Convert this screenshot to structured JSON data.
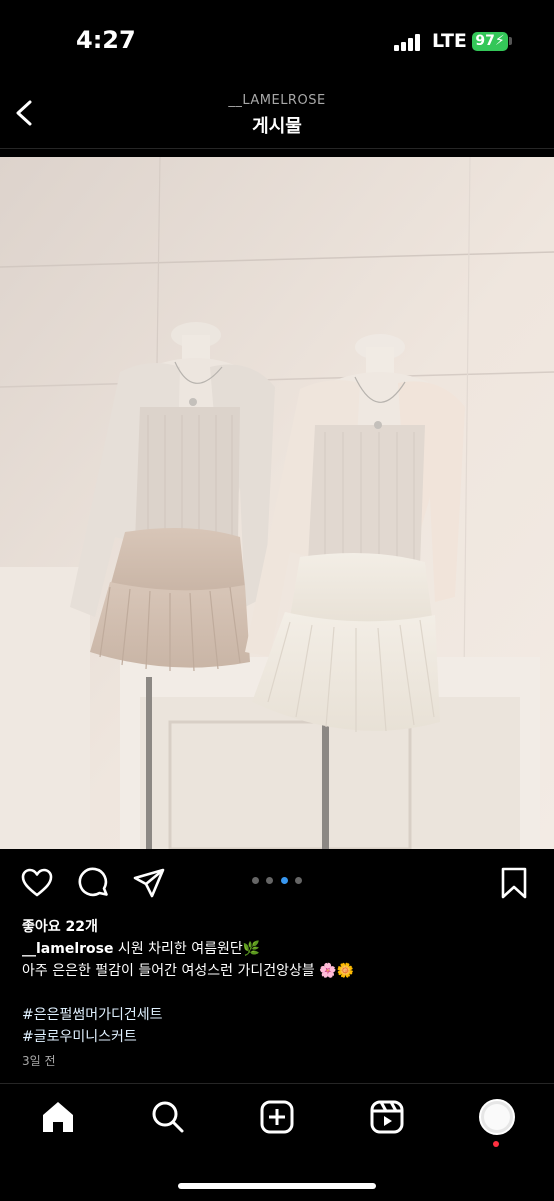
{
  "status": {
    "time": "4:27",
    "network": "LTE",
    "battery": "97"
  },
  "header": {
    "account": "__LAMELROSE",
    "title": "게시물"
  },
  "post": {
    "carousel_dots": 4,
    "active_dot": 2,
    "likes": "좋아요 22개",
    "username": "__lamelrose",
    "caption_line1": " 시원 차리한 여름원단🌿",
    "caption_line2": "아주 은은한 펄감이 들어간 여성스런 가디건앙상블 🌸🌼",
    "hashtags": [
      "#은은펄썸머가디건세트",
      "#글로우미니스커트"
    ],
    "time_ago": "3일 전"
  },
  "tabbar": {
    "items": [
      "home-icon",
      "search-icon",
      "create-icon",
      "reels-icon",
      "profile-icon"
    ]
  }
}
